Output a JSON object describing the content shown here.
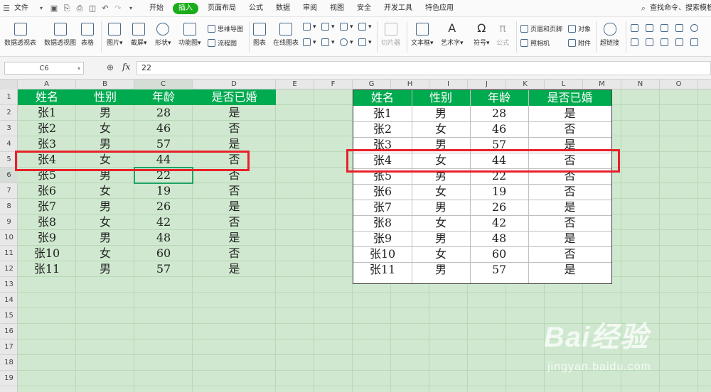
{
  "menubar": {
    "file": "文件",
    "tabs": [
      "开始",
      "插入",
      "页面布局",
      "公式",
      "数据",
      "审阅",
      "视图",
      "安全",
      "开发工具",
      "特色应用"
    ],
    "active_tab": "插入",
    "search": "查找命令、搜索模板"
  },
  "ribbon": {
    "pivot_table": "数据透视表",
    "pivot_chart": "数据透视图",
    "table": "表格",
    "picture": "图片",
    "screenshot": "截屏",
    "shape": "形状",
    "function_chart": "功能图",
    "mind_map": "思维导图",
    "flowchart": "流程图",
    "chart": "图表",
    "online_chart": "在线图表",
    "slicer": "切片器",
    "textbox": "文本框",
    "wordart": "艺术字",
    "symbol": "符号",
    "formula": "公式",
    "header_footer": "页眉和页脚",
    "camera": "照相机",
    "object": "对象",
    "attachment": "附件",
    "hyperlink": "超链接"
  },
  "formula_bar": {
    "name_box": "C6",
    "fx": "fx",
    "value": "22"
  },
  "columns": [
    "A",
    "B",
    "C",
    "D",
    "E",
    "F",
    "G",
    "H",
    "I",
    "J",
    "K",
    "L",
    "M",
    "N",
    "O"
  ],
  "rows": [
    "1",
    "2",
    "3",
    "4",
    "5",
    "6",
    "7",
    "8",
    "9",
    "10",
    "11",
    "12",
    "13",
    "14",
    "15",
    "16",
    "17",
    "18",
    "19"
  ],
  "table": {
    "headers": [
      "姓名",
      "性别",
      "年龄",
      "是否已婚"
    ],
    "rows": [
      [
        "张1",
        "男",
        "28",
        "是"
      ],
      [
        "张2",
        "女",
        "46",
        "否"
      ],
      [
        "张3",
        "男",
        "57",
        "是"
      ],
      [
        "张4",
        "女",
        "44",
        "否"
      ],
      [
        "张5",
        "男",
        "22",
        "否"
      ],
      [
        "张6",
        "女",
        "19",
        "否"
      ],
      [
        "张7",
        "男",
        "26",
        "是"
      ],
      [
        "张8",
        "女",
        "42",
        "否"
      ],
      [
        "张9",
        "男",
        "48",
        "是"
      ],
      [
        "张10",
        "女",
        "60",
        "否"
      ],
      [
        "张11",
        "男",
        "57",
        "是"
      ]
    ]
  },
  "watermark": {
    "title": "Bai经验",
    "url": "jingyan.baidu.com"
  }
}
